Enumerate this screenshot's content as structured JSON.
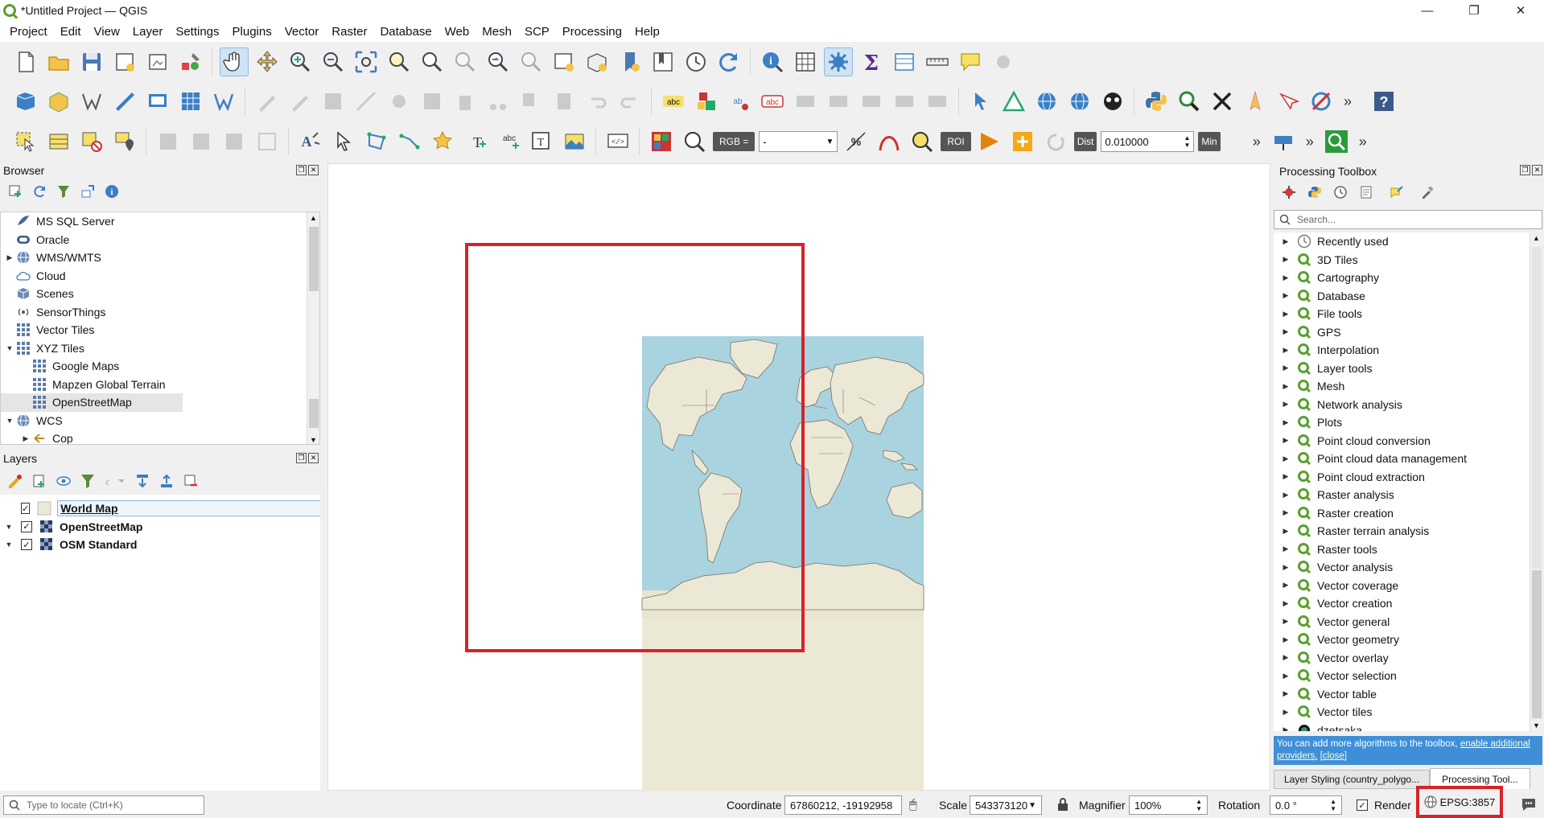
{
  "window": {
    "title": "*Untitled Project — QGIS",
    "controls": {
      "minimize": "—",
      "maximize": "❐",
      "close": "✕"
    }
  },
  "menubar": [
    "Project",
    "Edit",
    "View",
    "Layer",
    "Settings",
    "Plugins",
    "Vector",
    "Raster",
    "Database",
    "Web",
    "Mesh",
    "SCP",
    "Processing",
    "Help"
  ],
  "toolbar3": {
    "rgb_label": "RGB =",
    "rgb_value": "-",
    "roi_label": "ROI",
    "dist_label": "Dist",
    "dist_value": "0.010000",
    "min_label": "Min"
  },
  "browser": {
    "title": "Browser",
    "items": [
      {
        "label": "MS SQL Server",
        "arrow": "",
        "icon": "mssql-icon",
        "indent": 0
      },
      {
        "label": "Oracle",
        "arrow": "",
        "icon": "oracle-icon",
        "indent": 0
      },
      {
        "label": "WMS/WMTS",
        "arrow": "▶",
        "icon": "globe-icon",
        "indent": 0
      },
      {
        "label": "Cloud",
        "arrow": "",
        "icon": "cloud-icon",
        "indent": 0
      },
      {
        "label": "Scenes",
        "arrow": "",
        "icon": "scenes-icon",
        "indent": 0
      },
      {
        "label": "SensorThings",
        "arrow": "",
        "icon": "sensor-icon",
        "indent": 0
      },
      {
        "label": "Vector Tiles",
        "arrow": "",
        "icon": "grid-icon",
        "indent": 0
      },
      {
        "label": "XYZ Tiles",
        "arrow": "▼",
        "icon": "grid-icon",
        "indent": 0
      },
      {
        "label": "Google Maps",
        "arrow": "",
        "icon": "grid-icon",
        "indent": 1
      },
      {
        "label": "Mapzen Global Terrain",
        "arrow": "",
        "icon": "grid-icon",
        "indent": 1
      },
      {
        "label": "OpenStreetMap",
        "arrow": "",
        "icon": "grid-icon",
        "indent": 1,
        "selected": true
      },
      {
        "label": "WCS",
        "arrow": "▼",
        "icon": "globe-icon",
        "indent": 0
      },
      {
        "label": "Cop",
        "arrow": "▶",
        "icon": "service-icon",
        "indent": 1
      }
    ]
  },
  "layers": {
    "title": "Layers",
    "items": [
      {
        "label": "World Map",
        "checked": true,
        "arrow": "",
        "icon": "polygon-layer-icon",
        "bold": true,
        "underline": true,
        "selected": true
      },
      {
        "label": "OpenStreetMap",
        "checked": true,
        "arrow": "▼",
        "icon": "raster-layer-icon",
        "bold": true
      },
      {
        "label": "OSM Standard",
        "checked": true,
        "arrow": "▼",
        "icon": "raster-layer-icon",
        "bold": true
      }
    ]
  },
  "toolbox": {
    "title": "Processing Toolbox",
    "search_placeholder": "Search...",
    "items": [
      "Recently used",
      "3D Tiles",
      "Cartography",
      "Database",
      "File tools",
      "GPS",
      "Interpolation",
      "Layer tools",
      "Mesh",
      "Network analysis",
      "Plots",
      "Point cloud conversion",
      "Point cloud data management",
      "Point cloud extraction",
      "Raster analysis",
      "Raster creation",
      "Raster terrain analysis",
      "Raster tools",
      "Vector analysis",
      "Vector coverage",
      "Vector creation",
      "Vector general",
      "Vector geometry",
      "Vector overlay",
      "Vector selection",
      "Vector table",
      "Vector tiles",
      "dzetsaka"
    ],
    "info_text": "You can add more algorithms to the toolbox,",
    "info_link": "enable additional providers.",
    "info_close": "[close]",
    "tabs": [
      "Layer Styling (country_polygo...",
      "Processing Tool..."
    ]
  },
  "statusbar": {
    "locate_placeholder": "Type to locate (Ctrl+K)",
    "coordinate_label": "Coordinate",
    "coordinate_value": "67860212, -19192958",
    "scale_label": "Scale",
    "scale_value": "543373120",
    "magnifier_label": "Magnifier",
    "magnifier_value": "100%",
    "rotation_label": "Rotation",
    "rotation_value": "0.0 °",
    "render_label": "Render",
    "crs_value": "EPSG:3857"
  },
  "colors": {
    "ocean": "#a9d3df",
    "land": "#ece8d6",
    "highlight": "#d6232a",
    "qgis_green": "#5aa02c",
    "info_bg": "#3f8fd8"
  }
}
